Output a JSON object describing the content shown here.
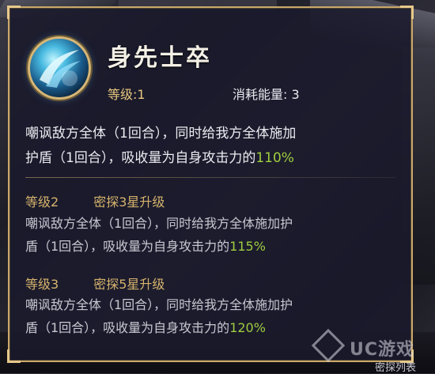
{
  "skill": {
    "name": "身先士卒",
    "level": "等级:1",
    "energy": "消耗能量: 3",
    "desc_line1_pre": "嘲讽敌方全体（1回合），同时给我方全体施加",
    "desc_line2_pre": "护盾（1回合），吸收量为自身攻击力的",
    "desc_value": "110%"
  },
  "upgrades": [
    {
      "level": "等级2",
      "requirement": "密探3星升级",
      "line1": "嘲讽敌方全体（1回合），同时给我方全体施加护",
      "line2_pre": "盾（1回合），吸收量为自身攻击力的",
      "value": "115%"
    },
    {
      "level": "等级3",
      "requirement": "密探5星升级",
      "line1": "嘲讽敌方全体（1回合），同时给我方全体施加护",
      "line2_pre": "盾（1回合），吸收量为自身攻击力的",
      "value": "120%"
    }
  ],
  "watermark": "UC游戏",
  "corner_text": "密探列表",
  "colors": {
    "panel_bg": "#1a1a2c",
    "border_gold": "#c9a86a",
    "level_gold": "#e8c77e",
    "value_green": "#9fcd3e"
  },
  "icons": {
    "skill": "blue-slash-skill-icon"
  }
}
